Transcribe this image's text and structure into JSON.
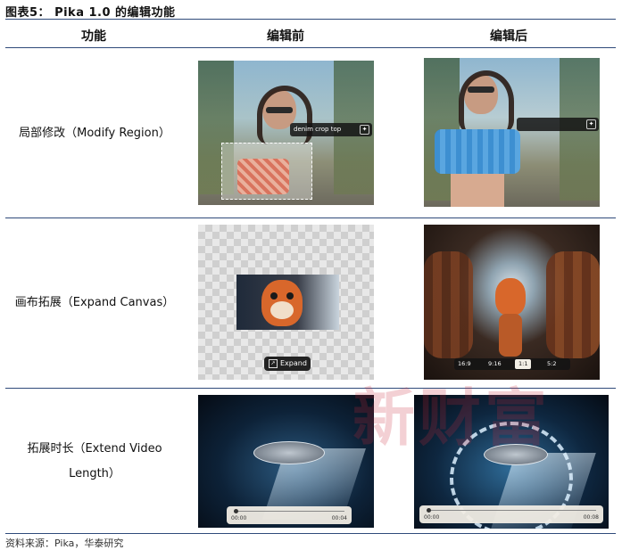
{
  "figure": {
    "title": "图表5：  Pika 1.0 的编辑功能",
    "source": "资料来源：Pika，华泰研究",
    "watermark": "新财富"
  },
  "headers": {
    "feature": "功能",
    "before": "编辑前",
    "after": "编辑后"
  },
  "rows": [
    {
      "label": "局部修改（Modify Region）",
      "prompt": "denim crop top"
    },
    {
      "label": "画布拓展（Expand Canvas）",
      "expand_button": "Expand",
      "ratios": [
        "16:9",
        "9:16",
        "1:1",
        "5:2"
      ]
    },
    {
      "label_line1": "拓展时长（Extend Video",
      "label_line2": "Length）",
      "before_time_start": "00:00",
      "before_time_end": "00:04",
      "after_time_start": "00:00",
      "after_time_end": "00:08"
    }
  ]
}
